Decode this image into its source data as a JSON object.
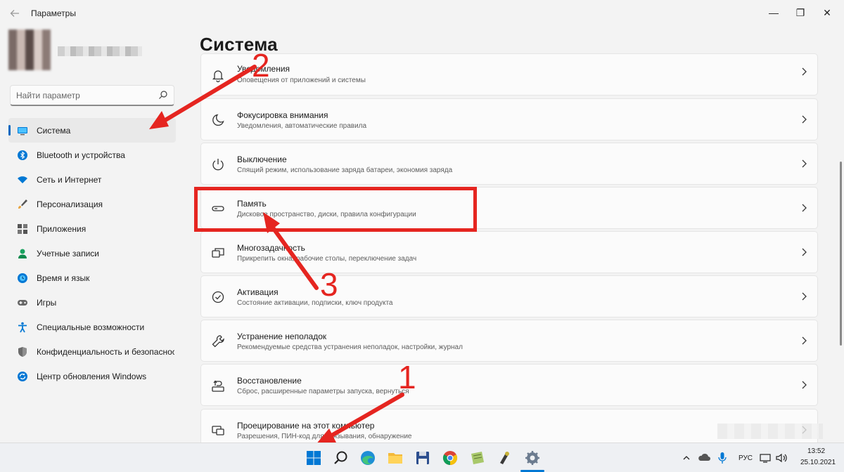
{
  "window": {
    "title": "Параметры",
    "back_icon": "arrow-left-icon",
    "minimize_glyph": "—",
    "maximize_glyph": "❐",
    "close_glyph": "✕"
  },
  "search": {
    "placeholder": "Найти параметр",
    "icon": "search-icon"
  },
  "sidebar": {
    "items": [
      {
        "label": "Система",
        "icon": "monitor-icon",
        "active": true
      },
      {
        "label": "Bluetooth и устройства",
        "icon": "bluetooth-icon"
      },
      {
        "label": "Сеть и Интернет",
        "icon": "wifi-icon"
      },
      {
        "label": "Персонализация",
        "icon": "brush-icon"
      },
      {
        "label": "Приложения",
        "icon": "apps-icon"
      },
      {
        "label": "Учетные записи",
        "icon": "person-icon"
      },
      {
        "label": "Время и язык",
        "icon": "globe-clock-icon"
      },
      {
        "label": "Игры",
        "icon": "gamepad-icon"
      },
      {
        "label": "Специальные возможности",
        "icon": "accessibility-icon"
      },
      {
        "label": "Конфиденциальность и безопасность",
        "icon": "shield-icon"
      },
      {
        "label": "Центр обновления Windows",
        "icon": "update-icon"
      }
    ]
  },
  "main": {
    "title": "Система",
    "cards": [
      {
        "title": "Уведомления",
        "subtitle": "Оповещения от приложений и системы",
        "icon": "bell-icon"
      },
      {
        "title": "Фокусировка внимания",
        "subtitle": "Уведомления, автоматические правила",
        "icon": "moon-icon"
      },
      {
        "title": "Выключение",
        "subtitle": "Спящий режим, использование заряда батареи, экономия заряда",
        "icon": "power-icon"
      },
      {
        "title": "Память",
        "subtitle": "Дисковое пространство, диски, правила конфигурации",
        "icon": "storage-icon"
      },
      {
        "title": "Многозадачность",
        "subtitle": "Прикрепить окна, рабочие столы, переключение задач",
        "icon": "multitask-icon"
      },
      {
        "title": "Активация",
        "subtitle": "Состояние активации, подписки, ключ продукта",
        "icon": "check-circle-icon"
      },
      {
        "title": "Устранение неполадок",
        "subtitle": "Рекомендуемые средства устранения неполадок, настройки, журнал",
        "icon": "wrench-icon"
      },
      {
        "title": "Восстановление",
        "subtitle": "Сброс, расширенные параметры запуска, вернуться",
        "icon": "recovery-icon"
      },
      {
        "title": "Проецирование на этот компьютер",
        "subtitle": "Разрешения, ПИН-код для связывания, обнаружение",
        "icon": "projection-icon"
      }
    ]
  },
  "annotations": {
    "n1": "1",
    "n2": "2",
    "n3": "3",
    "color": "#e52520"
  },
  "taskbar": {
    "apps": [
      "start-icon",
      "search-icon",
      "edge-icon",
      "explorer-icon",
      "floppy-icon",
      "chrome-icon",
      "notepad-icon",
      "tool-icon",
      "settings-icon"
    ],
    "tray": {
      "language": "РУС",
      "time": "13:52",
      "date": "25.10.2021"
    }
  },
  "colors": {
    "accent": "#0067c0",
    "annotation": "#e52520",
    "background": "#f3f3f3"
  }
}
